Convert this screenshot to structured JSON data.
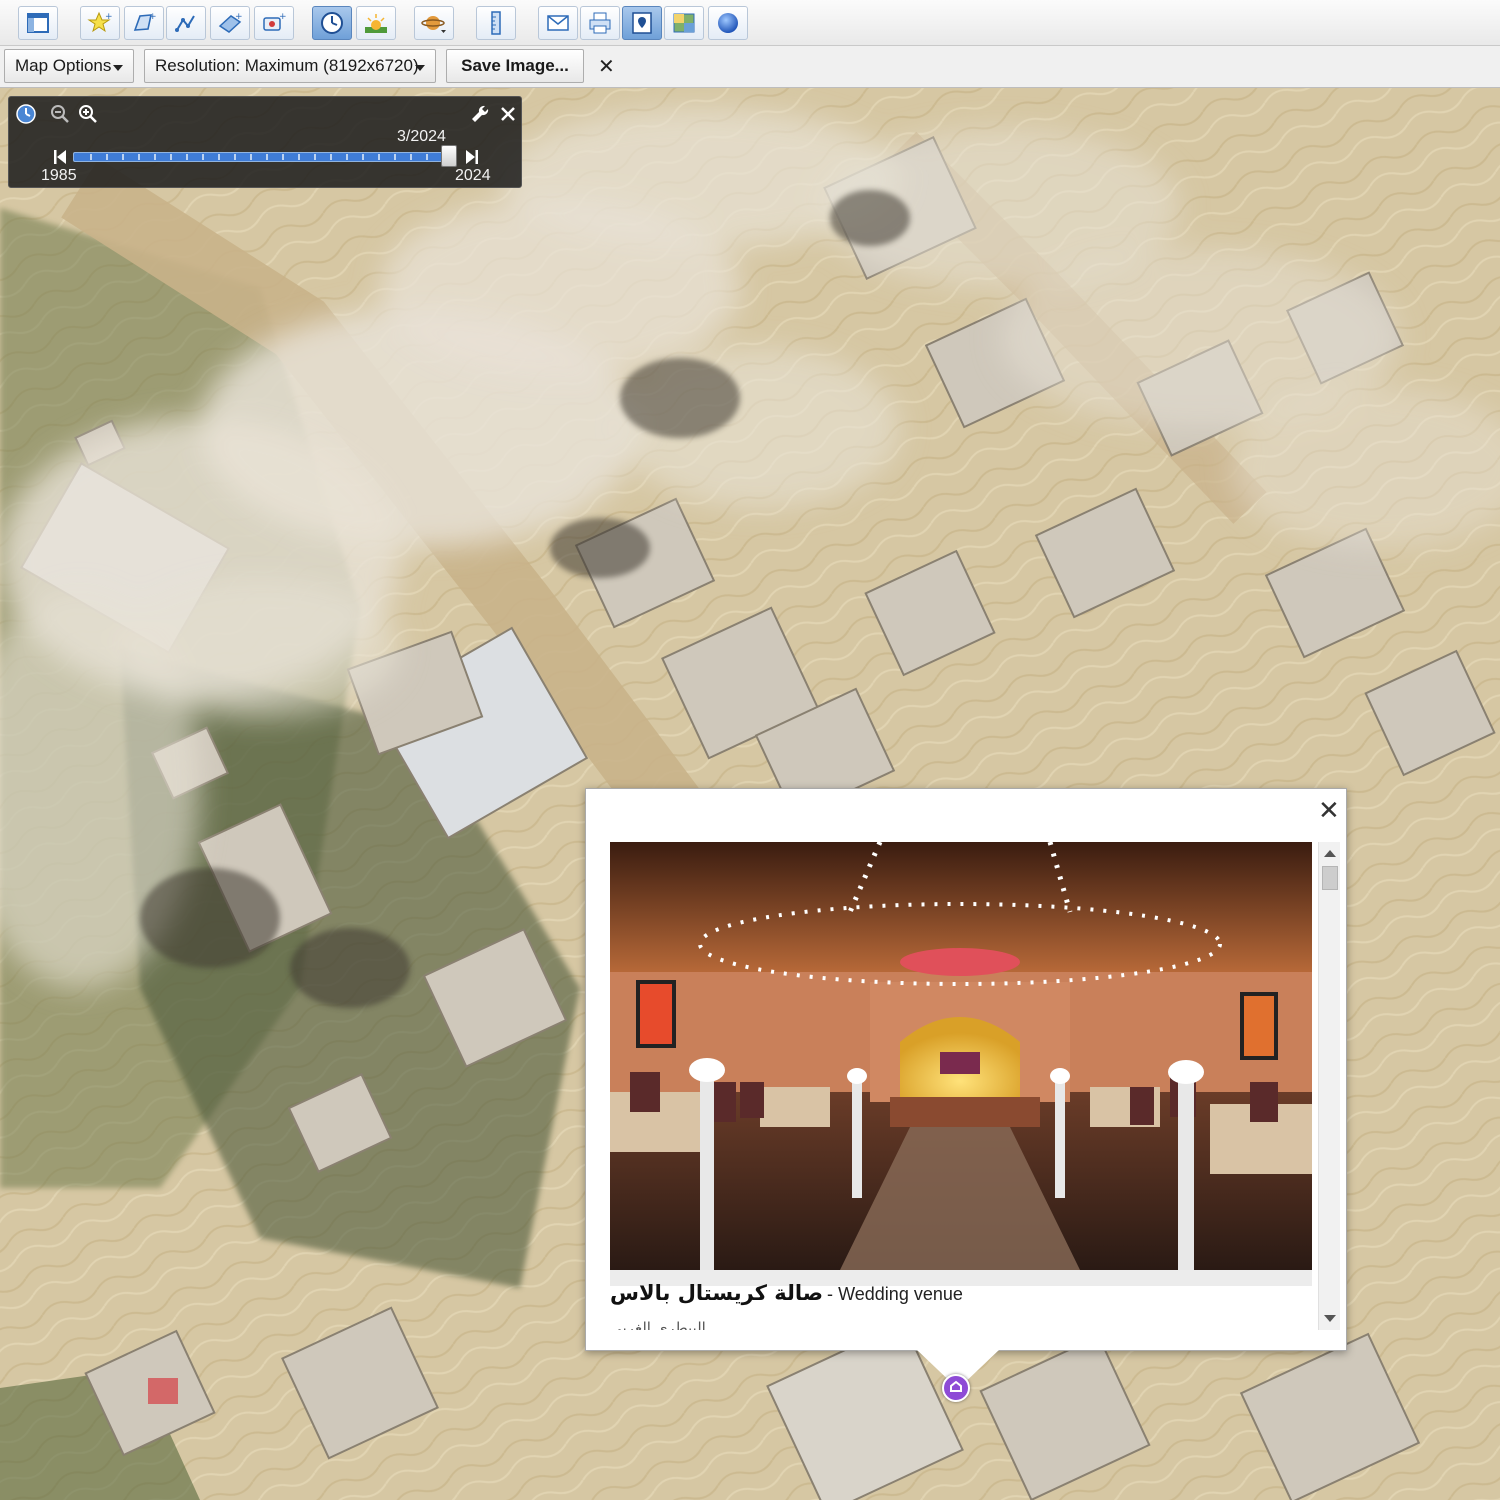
{
  "toolbar": {
    "buttons": [
      {
        "icon": "sidebar-icon",
        "active": false
      },
      {
        "icon": "add-placemark-icon",
        "active": false
      },
      {
        "icon": "add-polygon-icon",
        "active": false
      },
      {
        "icon": "add-path-icon",
        "active": false
      },
      {
        "icon": "add-image-overlay-icon",
        "active": false
      },
      {
        "icon": "record-tour-icon",
        "active": false
      },
      {
        "icon": "historical-imagery-icon",
        "active": true
      },
      {
        "icon": "sunlight-icon",
        "active": false
      },
      {
        "icon": "planets-icon",
        "active": false
      },
      {
        "icon": "ruler-icon",
        "active": false
      },
      {
        "icon": "email-icon",
        "active": false
      },
      {
        "icon": "print-icon",
        "active": false
      },
      {
        "icon": "save-image-icon",
        "active": true
      },
      {
        "icon": "view-in-maps-icon",
        "active": false
      },
      {
        "icon": "earth-icon",
        "active": false
      }
    ]
  },
  "options_bar": {
    "map_options_label": "Map Options",
    "resolution_label": "Resolution: Maximum (8192x6720)",
    "save_image_label": "Save Image...",
    "close_glyph": "✕"
  },
  "time_slider": {
    "current_label": "3/2024",
    "start_year": "1985",
    "end_year": "2024",
    "position_fraction": 1.0
  },
  "balloon": {
    "close_glyph": "✕",
    "place_name": "صالة كريستال بالاس",
    "separator": "-",
    "category": "Wedding venue",
    "address_partial": "البيطري الغربي"
  },
  "colors": {
    "toolbar_active": "#6fa0d8",
    "slider_fill": "#3f7cd6",
    "marker": "#8e4bd6",
    "panel_bg": "#1c1c1c"
  }
}
